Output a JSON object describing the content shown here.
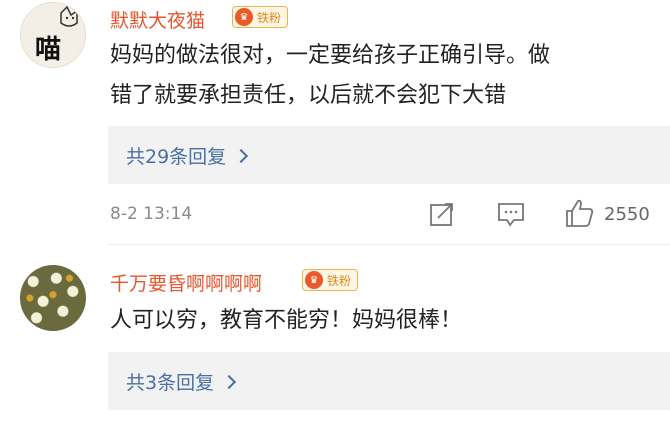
{
  "comments": [
    {
      "username": "默默大夜猫",
      "badge": "铁粉",
      "avatar": "cat-doodle-avatar",
      "avatar_text": "喵",
      "content_lines": [
        "妈妈的做法很对，一定要给孩子正确引导。做",
        "错了就要承担责任，以后就不会犯下大错"
      ],
      "reply_summary": "共29条回复",
      "date": "8-2 13:14",
      "likes": "2550",
      "actions": [
        "share-icon",
        "comment-icon",
        "like-icon"
      ]
    },
    {
      "username": "千万要昏啊啊啊啊",
      "badge": "铁粉",
      "avatar": "daisy-flowers-avatar",
      "content_lines": [
        "人可以穷，教育不能穷！妈妈很棒！"
      ],
      "reply_summary": "共3条回复"
    }
  ],
  "colors": {
    "username": "#e8562d",
    "reply_link": "#4a6fa5",
    "reply_bg": "#f2f2f2",
    "meta": "#8a8a8a"
  }
}
